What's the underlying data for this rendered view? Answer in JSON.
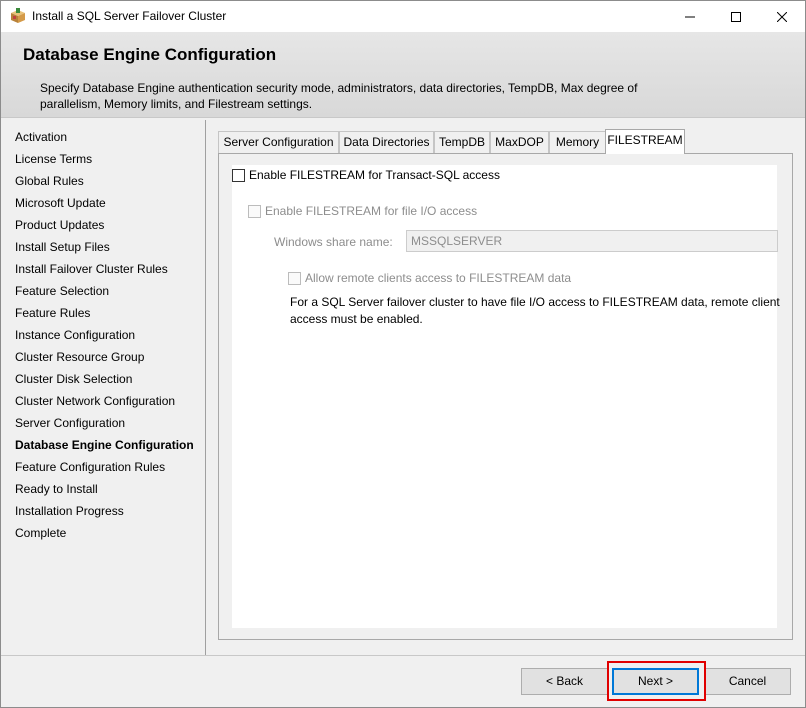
{
  "window": {
    "title": "Install a SQL Server Failover Cluster",
    "icons": {
      "app": "sql-setup-box-icon",
      "minimize": "minimize-icon",
      "maximize": "maximize-icon",
      "close": "close-icon"
    }
  },
  "header": {
    "title": "Database Engine Configuration",
    "description": "Specify Database Engine authentication security mode, administrators, data directories, TempDB, Max degree of parallelism, Memory limits, and Filestream settings."
  },
  "nav": {
    "items": [
      "Activation",
      "License Terms",
      "Global Rules",
      "Microsoft Update",
      "Product Updates",
      "Install Setup Files",
      "Install Failover Cluster Rules",
      "Feature Selection",
      "Feature Rules",
      "Instance Configuration",
      "Cluster Resource Group",
      "Cluster Disk Selection",
      "Cluster Network Configuration",
      "Server Configuration",
      "Database Engine Configuration",
      "Feature Configuration Rules",
      "Ready to Install",
      "Installation Progress",
      "Complete"
    ],
    "active": "Database Engine Configuration"
  },
  "tabs": {
    "items": [
      "Server Configuration",
      "Data Directories",
      "TempDB",
      "MaxDOP",
      "Memory",
      "FILESTREAM"
    ],
    "selected": "FILESTREAM"
  },
  "filestream": {
    "enable_tsql_label": "Enable FILESTREAM for Transact-SQL access",
    "enable_tsql_checked": false,
    "enable_fileio_label": "Enable FILESTREAM for file I/O access",
    "enable_fileio_checked": false,
    "share_name_label": "Windows share name:",
    "share_name_value": "MSSQLSERVER",
    "allow_remote_label": "Allow remote clients access to FILESTREAM data",
    "allow_remote_checked": false,
    "info_text": "For a SQL Server failover cluster to have file I/O access to FILESTREAM data, remote client access must be enabled."
  },
  "buttons": {
    "back": "< Back",
    "next": "Next >",
    "cancel": "Cancel"
  },
  "colors": {
    "highlight": "#e00000",
    "default_button_border": "#0078d7"
  }
}
